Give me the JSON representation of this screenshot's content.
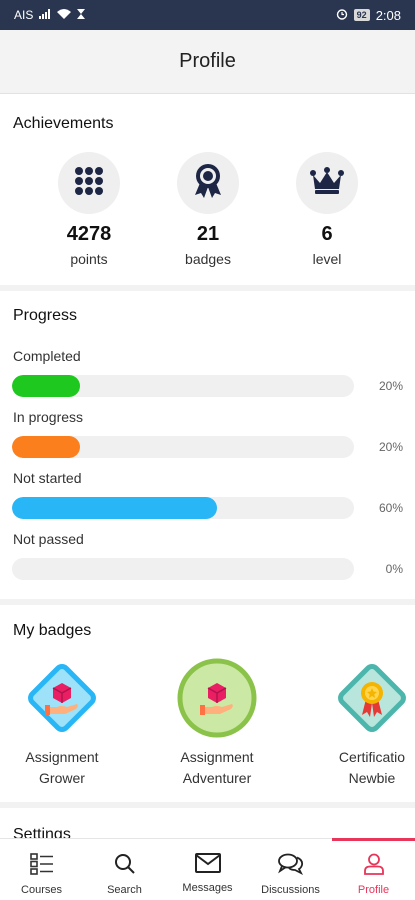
{
  "status_bar": {
    "carrier": "AIS",
    "time": "2:08",
    "battery": "92"
  },
  "header": {
    "title": "Profile"
  },
  "achievements": {
    "title": "Achievements",
    "items": [
      {
        "icon": "grid-dots-icon",
        "value": "4278",
        "label": "points"
      },
      {
        "icon": "ribbon-badge-icon",
        "value": "21",
        "label": "badges"
      },
      {
        "icon": "crown-icon",
        "value": "6",
        "label": "level"
      }
    ]
  },
  "progress": {
    "title": "Progress",
    "items": [
      {
        "label": "Completed",
        "percent": "20%",
        "value": 0.2,
        "color": "#1ec81e"
      },
      {
        "label": "In progress",
        "percent": "20%",
        "value": 0.2,
        "color": "#fb7f1c"
      },
      {
        "label": "Not started",
        "percent": "60%",
        "value": 0.6,
        "color": "#29b6f6"
      },
      {
        "label": "Not passed",
        "percent": "0%",
        "value": 0,
        "color": "#e8355a"
      }
    ]
  },
  "badges": {
    "title": "My badges",
    "items": [
      {
        "line1": "Assignment",
        "line2": "Grower",
        "shape": "diamond",
        "color": "#29b6f6"
      },
      {
        "line1": "Assignment",
        "line2": "Adventurer",
        "shape": "circle",
        "color": "#8bc34a"
      },
      {
        "line1": "Certificatio",
        "line2": "Newbie",
        "shape": "diamond",
        "color": "#4db6ac"
      }
    ]
  },
  "settings": {
    "title": "Settings"
  },
  "nav": {
    "items": [
      {
        "label": "Courses",
        "icon": "courses-list-icon"
      },
      {
        "label": "Search",
        "icon": "search-icon"
      },
      {
        "label": "Messages",
        "icon": "envelope-icon"
      },
      {
        "label": "Discussions",
        "icon": "chat-bubbles-icon"
      },
      {
        "label": "Profile",
        "icon": "person-icon",
        "active": true
      }
    ]
  }
}
